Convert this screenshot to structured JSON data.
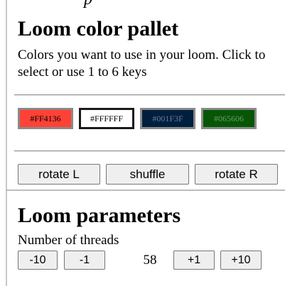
{
  "loom_colors": {
    "title": "Loom color pallet",
    "description": "Colors you want to use in your loom. Click to select or use 1 to 6 keys",
    "swatches": [
      {
        "label": "#FF4136",
        "color": "#FF4136",
        "text_color": "#000000",
        "selected": false
      },
      {
        "label": "#FFFFFF",
        "color": "#FFFFFF",
        "text_color": "#000000",
        "selected": true
      },
      {
        "label": "#001F3F",
        "color": "#001F3F",
        "text_color": "#6a7d94",
        "selected": false
      },
      {
        "label": "#065606",
        "color": "#065606",
        "text_color": "#6e9a6e",
        "selected": false
      }
    ],
    "rotate_left_label": "rotate L",
    "shuffle_label": "shuffle",
    "rotate_right_label": "rotate R"
  },
  "loom_parameters": {
    "title": "Loom parameters",
    "threads_label": "Number of threads",
    "minus10_label": "-10",
    "minus1_label": "-1",
    "threads_value": "58",
    "plus1_label": "+1",
    "plus10_label": "+10"
  }
}
